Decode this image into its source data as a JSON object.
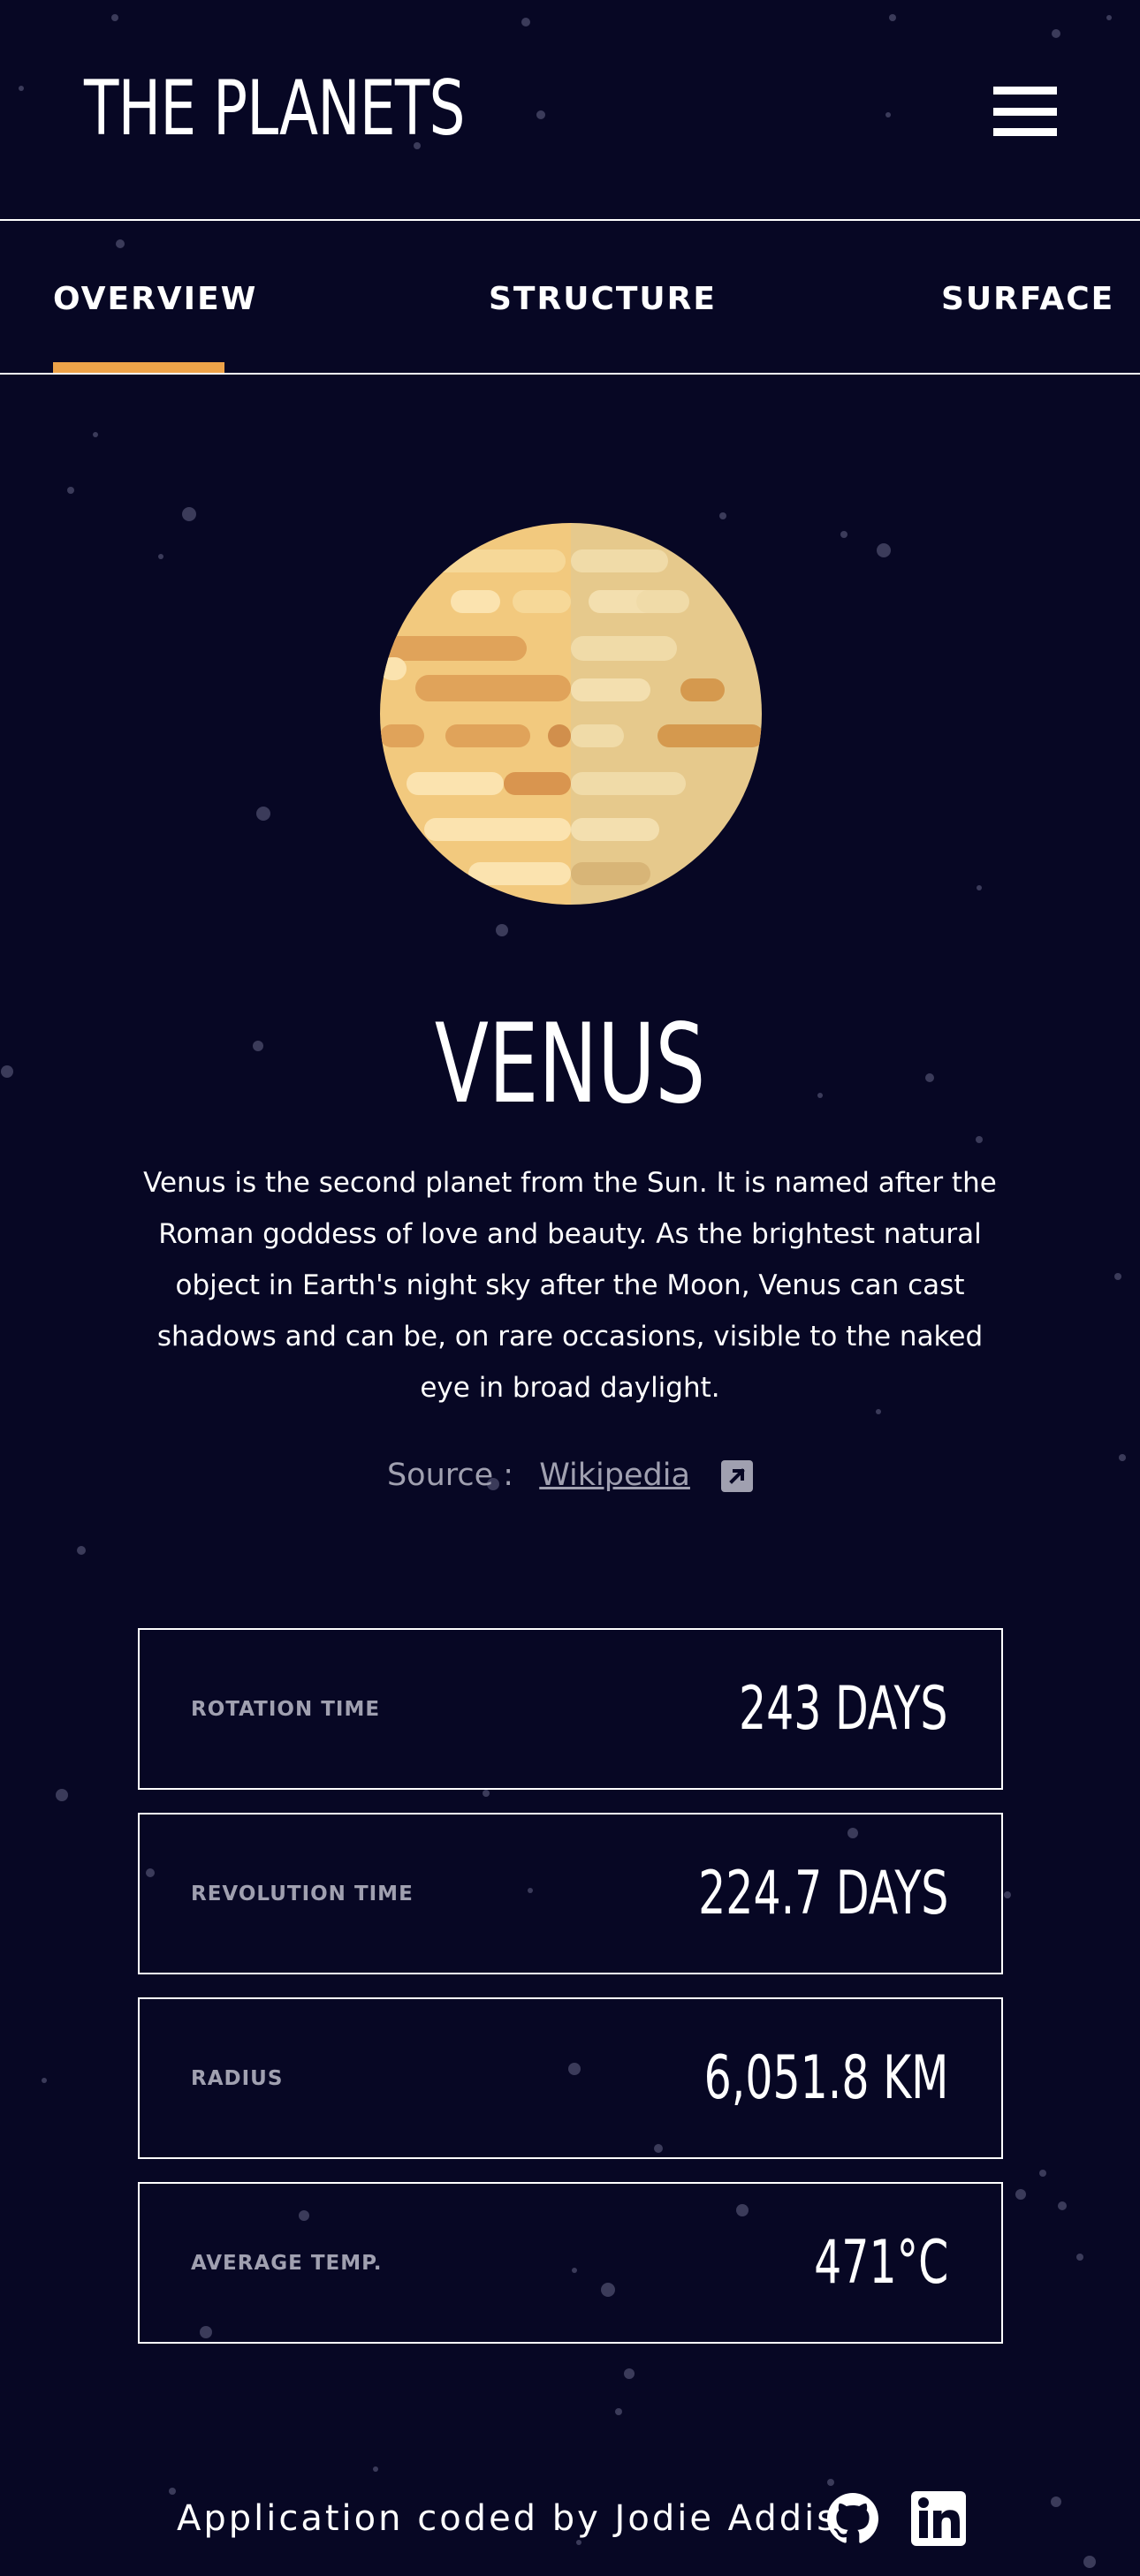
{
  "header": {
    "logo": "THE PLANETS",
    "menu_icon": "hamburger-menu-icon"
  },
  "tabs": [
    {
      "label": "OVERVIEW",
      "active": true
    },
    {
      "label": "STRUCTURE",
      "active": false
    },
    {
      "label": "SURFACE",
      "active": false
    }
  ],
  "planet": {
    "name": "VENUS",
    "description": "Venus is the second planet from the Sun. It is named after the Roman goddess of love and beauty. As the brightest natural object in Earth's night sky after the Moon, Venus can cast shadows and can be, on rare occasions, visible to the naked eye in broad daylight.",
    "source_label": "Source :",
    "source_link": "Wikipedia",
    "source_icon": "external-link-icon"
  },
  "stats": [
    {
      "label": "ROTATION TIME",
      "value": "243 DAYS"
    },
    {
      "label": "REVOLUTION TIME",
      "value": "224.7 DAYS"
    },
    {
      "label": "RADIUS",
      "value": "6,051.8 KM"
    },
    {
      "label": "AVERAGE TEMP.",
      "value": "471°C"
    }
  ],
  "footer": {
    "text": "Application coded by Jodie Addis",
    "icons": [
      "github-icon",
      "linkedin-icon"
    ]
  },
  "colors": {
    "background": "#070724",
    "accent": "#EDA249",
    "muted_text": "#a0a0b0"
  }
}
